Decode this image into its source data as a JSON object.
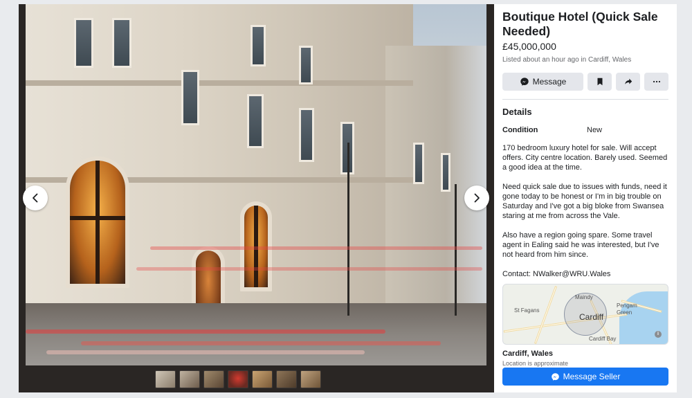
{
  "listing": {
    "title": "Boutique Hotel (Quick Sale Needed)",
    "price": "£45,000,000",
    "listed": "Listed about an hour ago in Cardiff, Wales"
  },
  "actions": {
    "message_label": "Message",
    "bookmark_icon": "bookmark-icon",
    "share_icon": "share-icon",
    "more_icon": "more-icon"
  },
  "details": {
    "heading": "Details",
    "condition_label": "Condition",
    "condition_value": "New",
    "description": "170 bedroom luxury hotel for sale. Will accept offers. City centre location. Barely used. Seemed a good idea at the time.\n\nNeed quick sale due to issues with funds, need it gone today to be honest or I'm in big trouble on Saturday and I've got a big bloke from Swansea staring at me from across the Vale.\n\nAlso have a region going spare. Some travel agent in Ealing said he was interested, but I've not heard from him since.\n\nContact: NWalker@WRU.Wales"
  },
  "map": {
    "city": "Cardiff",
    "labels": [
      "Maindy",
      "St Fagans",
      "Pengam Green",
      "Cardiff Bay"
    ],
    "info": "i"
  },
  "location": {
    "title": "Cardiff, Wales",
    "subtitle": "Location is approximate"
  },
  "seller_button": "Message Seller",
  "gallery": {
    "thumbnail_count": 7,
    "colors": {
      "accent": "#1877f2",
      "button_bg": "#e4e6eb",
      "panel_bg": "#2a2624"
    }
  }
}
